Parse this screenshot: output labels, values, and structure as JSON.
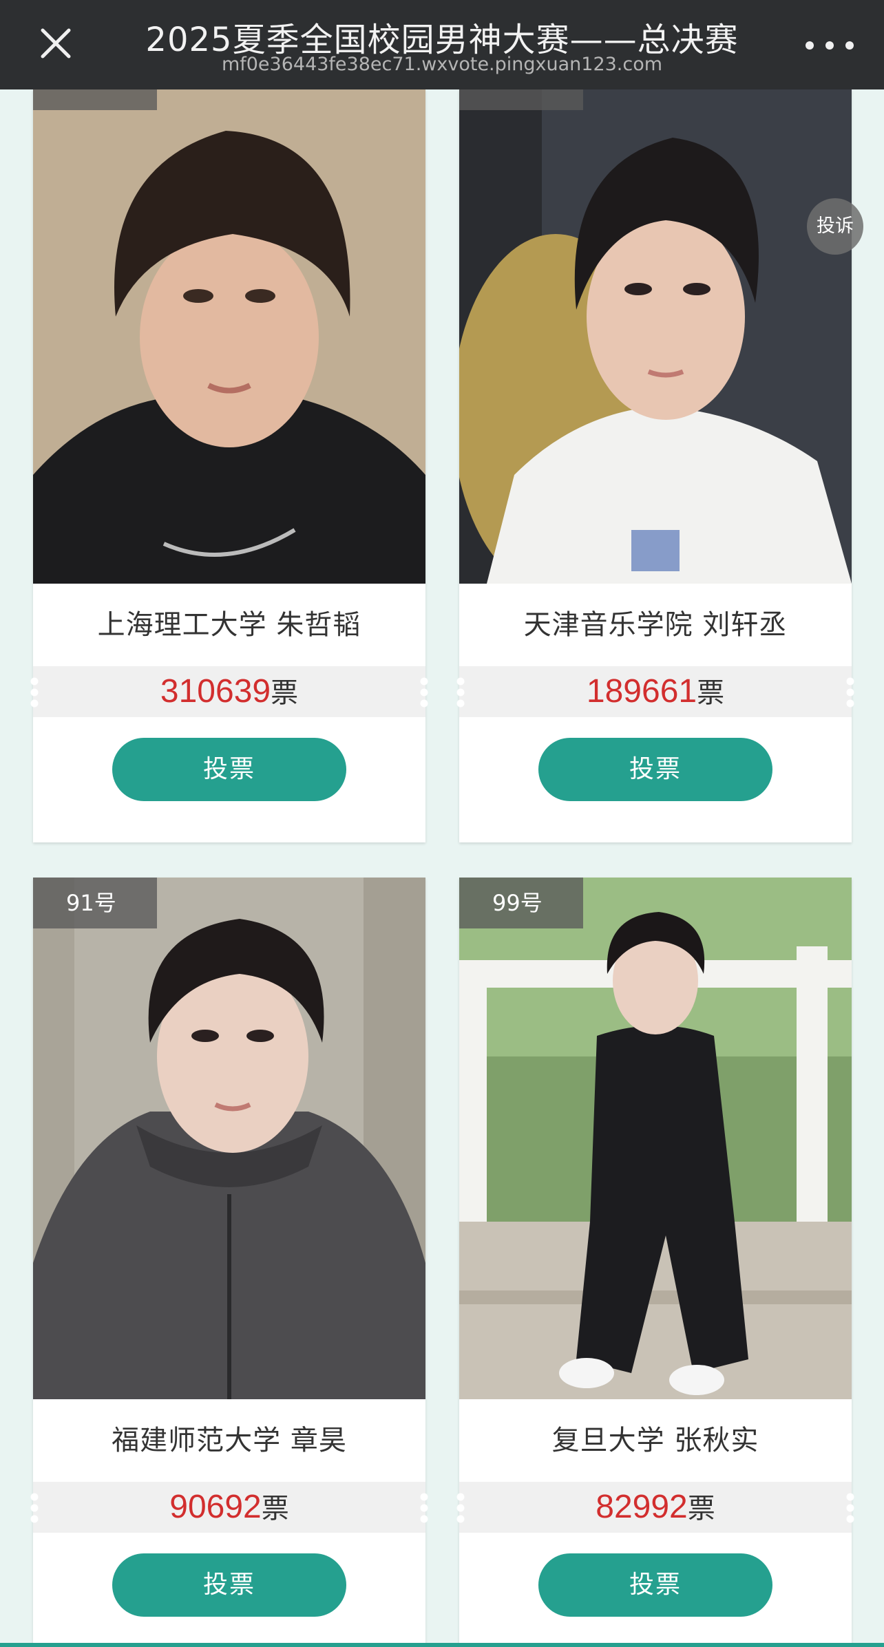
{
  "header": {
    "title": "2025夏季全国校园男神大赛——总决赛",
    "url": "mf0e36443fe38ec71.wxvote.pingxuan123.com"
  },
  "complain_label": "投诉",
  "vote_unit": "票",
  "vote_button_label": "投票",
  "contestants": [
    {
      "number": "",
      "name": "上海理工大学 朱哲韬",
      "votes": "310639"
    },
    {
      "number": "",
      "name": "天津音乐学院 刘轩丞",
      "votes": "189661"
    },
    {
      "number": "91号",
      "name": "福建师范大学 章昊",
      "votes": "90692"
    },
    {
      "number": "99号",
      "name": "复旦大学 张秋实",
      "votes": "82992"
    }
  ],
  "colors": {
    "accent": "#25a08f",
    "vote_count": "#d22e2e",
    "topbar": "#2d2f31",
    "page_background": "#e9f4f2"
  }
}
